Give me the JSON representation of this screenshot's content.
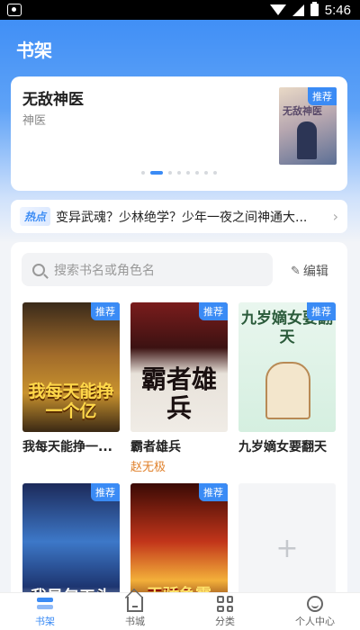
{
  "status_bar": {
    "time": "5:46",
    "icons": [
      "paw-icon",
      "wifi-icon",
      "signal-icon",
      "battery-icon"
    ]
  },
  "header": {
    "title": "书架"
  },
  "banner": {
    "title": "无敌神医",
    "subtitle": "神医",
    "badge": "推荐",
    "cover_text": "无敌神医",
    "page_count": 8,
    "active_page": 1
  },
  "hot": {
    "tag": "热点",
    "text": "变异武魂？少林绝学？少年一夜之间神通大..."
  },
  "search": {
    "placeholder": "搜索书名或角色名"
  },
  "edit": {
    "label": "编辑"
  },
  "books": [
    {
      "title": "我每天能挣一...",
      "author": "",
      "badge": "推荐",
      "cover_text": "我每天能挣一个亿"
    },
    {
      "title": "霸者雄兵",
      "author": "赵无极",
      "badge": "推荐",
      "cover_text": "霸者雄兵"
    },
    {
      "title": "九岁嫡女要翻天",
      "author": "",
      "badge": "推荐",
      "cover_text": "九岁嫡女要翻天"
    },
    {
      "title": "",
      "author": "",
      "badge": "推荐",
      "cover_text": "我是包工头"
    },
    {
      "title": "",
      "author": "",
      "badge": "推荐",
      "cover_text": "天骄争霸"
    }
  ],
  "add_label": "+",
  "nav": [
    {
      "label": "书架",
      "icon": "bookshelf-icon",
      "active": true
    },
    {
      "label": "书城",
      "icon": "bookstore-icon",
      "active": false
    },
    {
      "label": "分类",
      "icon": "category-grid-icon",
      "active": false
    },
    {
      "label": "个人中心",
      "icon": "user-icon",
      "active": false
    }
  ],
  "colors": {
    "accent": "#3a8bf5",
    "author": "#e0802a"
  }
}
